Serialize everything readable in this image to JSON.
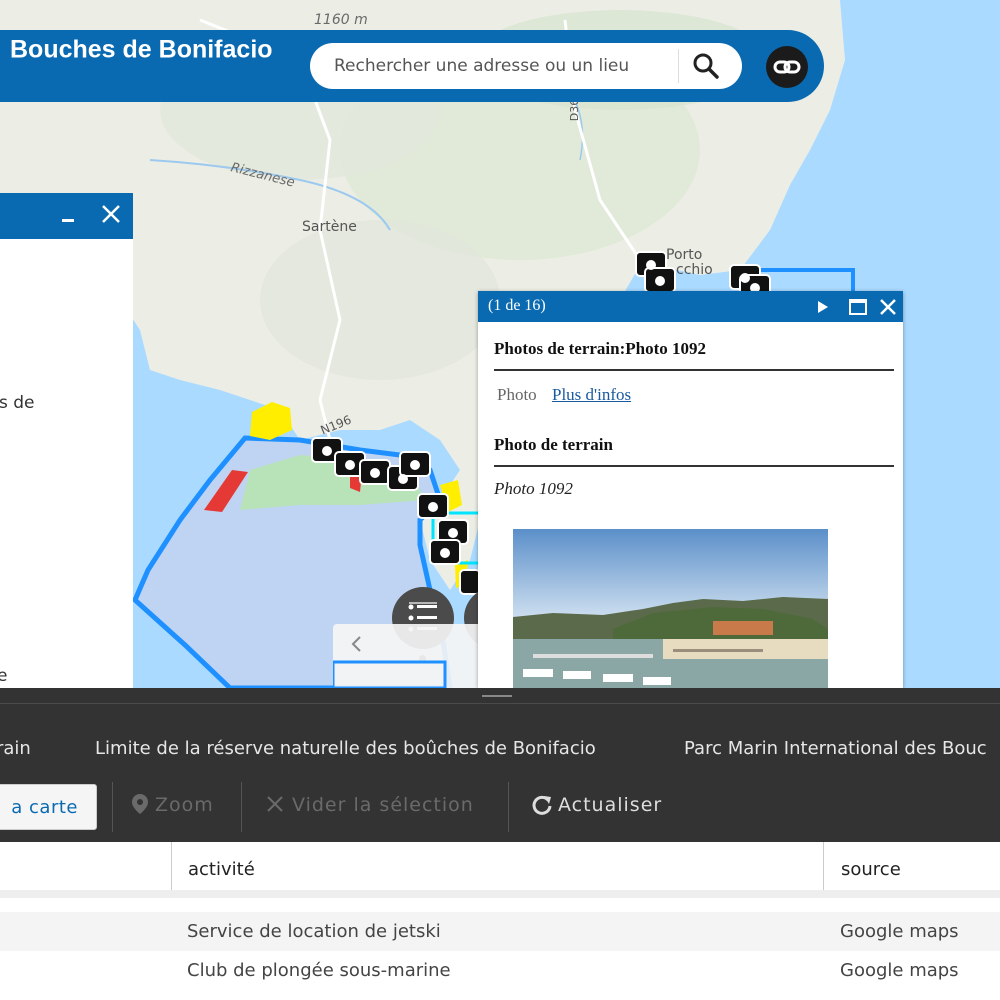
{
  "app": {
    "title": "Bouches de Bonifacio"
  },
  "search": {
    "placeholder": "Rechercher une adresse ou un lieu"
  },
  "map": {
    "labels": {
      "elevation": "1160 m",
      "river": "Rizzanese",
      "town_sartene": "Sartène",
      "town_porto": "Porto",
      "town_vecchio": "cchio",
      "road": "N196",
      "road2": "D368"
    },
    "colors": {
      "land": "#eef0e9",
      "sea": "#aadaff",
      "zone": "#bcd2f2",
      "zone_border": "#1e90ff",
      "green_zone": "#b5e3b6",
      "yellow": "#ffee00",
      "red": "#e53935"
    }
  },
  "left_panel": {
    "snippet_1": "s de",
    "snippet_2": "e"
  },
  "popup": {
    "counter": "(1 de 16)",
    "title": "Photos de terrain:Photo 1092",
    "field_label": "Photo",
    "link_text": "Plus d'infos",
    "section_title": "Photo de terrain",
    "caption": "Photo 1092"
  },
  "table": {
    "tabs": [
      "rain",
      "Limite de la réserve naturelle des boûches de Bonifacio",
      "Parc Marin International des Bouc"
    ],
    "toolbar": {
      "map_label": "a carte",
      "zoom_label": "Zoom",
      "clear_label": "Vider la sélection",
      "refresh_label": "Actualiser"
    },
    "columns": [
      "activité",
      "source"
    ],
    "rows": [
      {
        "activite": "Service de location de jetski",
        "source": "Google maps"
      },
      {
        "activite": "Club de plongée sous-marine",
        "source": "Google maps"
      }
    ]
  }
}
